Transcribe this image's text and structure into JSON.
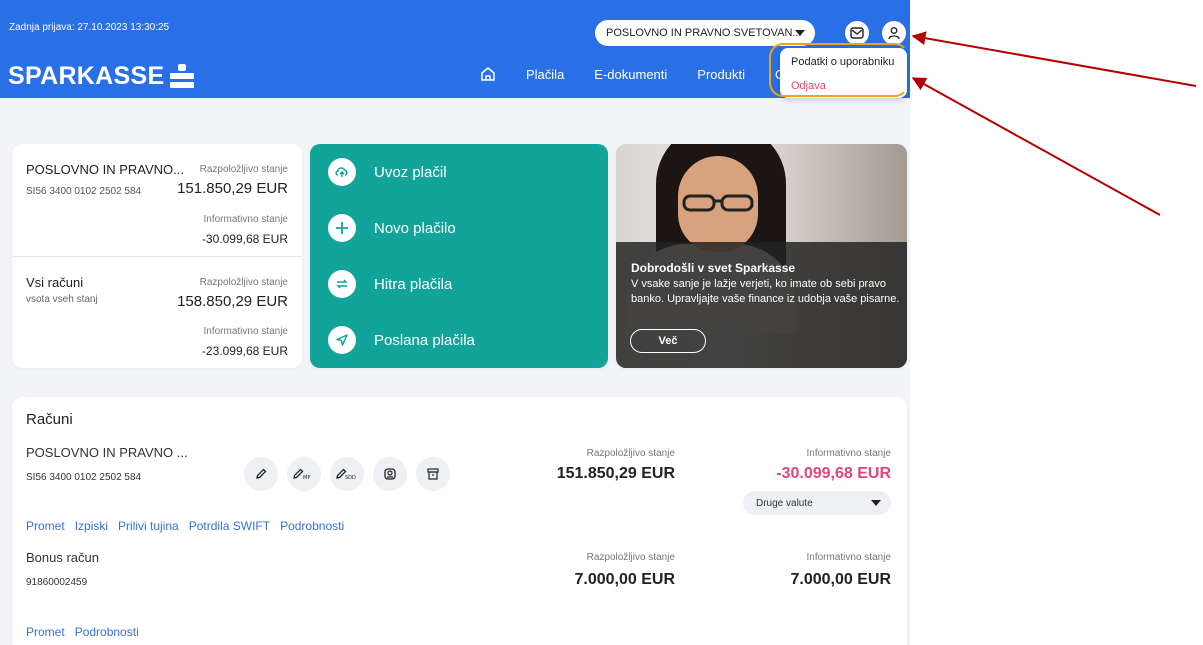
{
  "header": {
    "last_login": "Zadnja prijava: 27.10.2023 13:30:25",
    "brand": "SPARKASSE",
    "company_select": "POSLOVNO IN PRAVNO SVETOVAN...",
    "nav": [
      "Plačila",
      "E-dokumenti",
      "Produkti",
      "O"
    ]
  },
  "user_menu": {
    "items": [
      "Podatki o uporabniku",
      "Odjava"
    ]
  },
  "summary": {
    "account_name": "POSLOVNO IN PRAVNO...",
    "account_iban": "SI56 3400 0102 2502 584",
    "available_label": "Razpoložljivo stanje",
    "available": "151.850,29 EUR",
    "info_label": "Informativno stanje",
    "info": "-30.099,68 EUR",
    "all_name": "Vsi računi",
    "all_sub": "vsota vseh stanj",
    "all_available_label": "Razpoložljivo stanje",
    "all_available": "158.850,29 EUR",
    "all_info_label": "Informativno stanje",
    "all_info": "-23.099,68 EUR"
  },
  "actions": [
    {
      "label": "Uvoz plačil",
      "icon": "cloud-upload-icon"
    },
    {
      "label": "Novo plačilo",
      "icon": "plus-icon"
    },
    {
      "label": "Hitra plačila",
      "icon": "repeat-icon"
    },
    {
      "label": "Poslana plačila",
      "icon": "send-icon"
    }
  ],
  "promo": {
    "title": "Dobrodošli v svet Sparkasse",
    "text": "V vsake sanje je lažje verjeti, ko imate ob sebi pravo banko. Upravljajte vaše finance iz udobja vaše pisarne.",
    "button": "Več"
  },
  "accounts": {
    "title": "Računi",
    "rows": [
      {
        "name": "POSLOVNO IN PRAVNO ...",
        "iban": "SI56 3400 0102 2502 584",
        "available_label": "Razpoložljivo stanje",
        "available": "151.850,29 EUR",
        "info_label": "Informativno stanje",
        "info": "-30.099,68 EUR",
        "currency_select": "Druge valute",
        "links": [
          "Promet",
          "Izpiski",
          "Prilivi tujina",
          "Potrdila SWIFT",
          "Podrobnosti"
        ]
      },
      {
        "name": "Bonus račun",
        "iban": "91860002459",
        "available_label": "Razpoložljivo stanje",
        "available": "7.000,00 EUR",
        "info_label": "Informativno stanje",
        "info": "7.000,00 EUR",
        "links": [
          "Promet",
          "Podrobnosti"
        ]
      }
    ],
    "tool_icons": [
      "pencil-icon",
      "pencil-mp-icon",
      "pencil-sdd-icon",
      "stamp-icon",
      "archive-icon"
    ],
    "tool_labels": [
      "MP",
      "SDD"
    ]
  },
  "colors": {
    "header_blue": "#2970e6",
    "action_teal": "#12a39a",
    "negative_pink": "#e0457b",
    "link_blue": "#3b6fd1",
    "annotation_red": "#b40000",
    "annotation_orange": "#f0a21a"
  }
}
